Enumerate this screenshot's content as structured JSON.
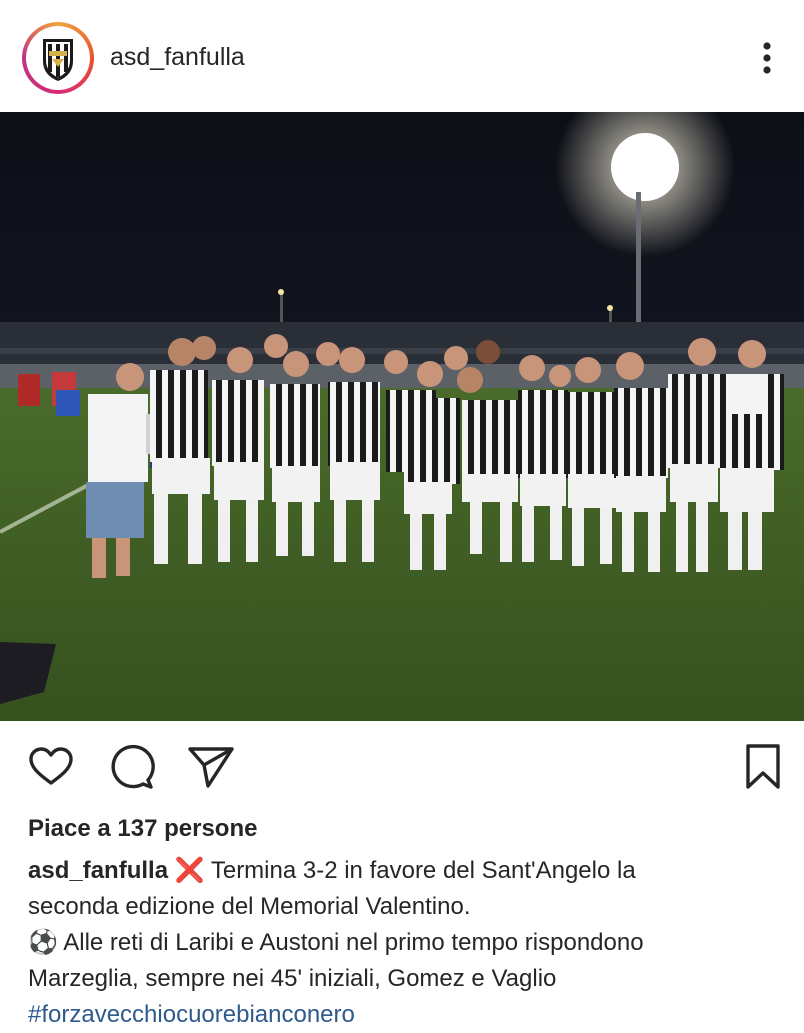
{
  "header": {
    "username": "asd_fanfulla",
    "avatar_icon": "shield-crest-icon",
    "more_icon": "more-vertical-icon"
  },
  "post": {
    "image_alt_icon": "team-photo-image",
    "actions": {
      "like_icon": "heart-icon",
      "comment_icon": "comment-icon",
      "share_icon": "send-icon",
      "save_icon": "bookmark-icon"
    },
    "likes_text": "Piace a 137 persone",
    "caption": {
      "username": "asd_fanfulla",
      "emoji_1": "❌",
      "line_1_text": "Termina 3-2 in favore del Sant'Angelo la",
      "line_2_text": "seconda edizione del Memorial Valentino.",
      "emoji_2": "⚽",
      "line_3_text": "Alle reti di Laribi e Austoni nel primo tempo rispondono",
      "line_4_text": "Marzeglia, sempre nei 45' iniziali, Gomez e Vaglio",
      "hashtag": "#forzavecchiocuorebianconero"
    }
  },
  "colors": {
    "text": "#262626",
    "hashtag": "#2f5a8c",
    "story_ring": "#d62976"
  }
}
